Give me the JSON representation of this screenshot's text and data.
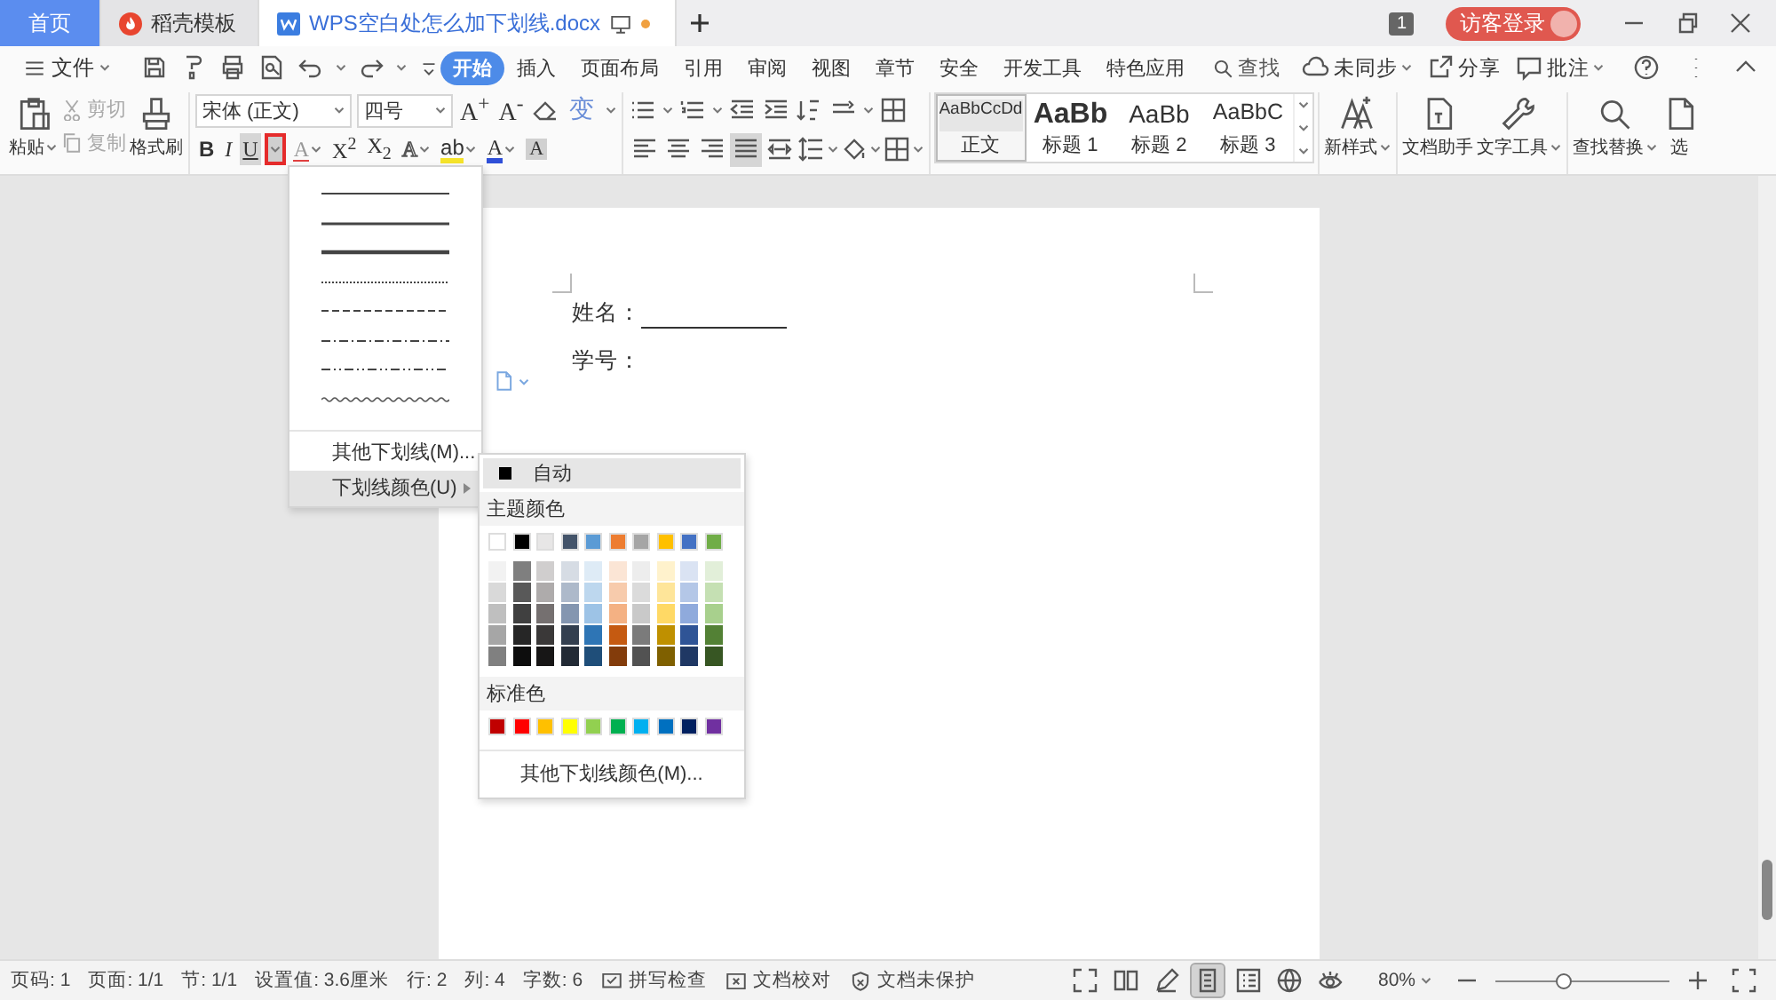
{
  "tab_bar": {
    "tabs": [
      {
        "kind": "home",
        "label": "首页",
        "selected": false
      },
      {
        "kind": "template",
        "label": "稻壳模板",
        "selected": false
      },
      {
        "kind": "document",
        "label": "WPS空白处怎么加下划线.docx",
        "selected": true
      }
    ],
    "badge": "1",
    "login": "访客登录"
  },
  "menu_bar": {
    "file": "文件",
    "tabs": [
      {
        "label": "开始",
        "selected": true
      },
      {
        "label": "插入",
        "selected": false
      },
      {
        "label": "页面布局",
        "selected": false
      },
      {
        "label": "引用",
        "selected": false
      },
      {
        "label": "审阅",
        "selected": false
      },
      {
        "label": "视图",
        "selected": false
      },
      {
        "label": "章节",
        "selected": false
      },
      {
        "label": "安全",
        "selected": false
      },
      {
        "label": "开发工具",
        "selected": false
      },
      {
        "label": "特色应用",
        "selected": false
      }
    ],
    "search": "查找",
    "actions": [
      {
        "kind": "sync",
        "label": "未同步"
      },
      {
        "kind": "share",
        "label": "分享"
      },
      {
        "kind": "comment",
        "label": "批注"
      }
    ]
  },
  "ribbon": {
    "paste": "粘贴",
    "cut": "剪切",
    "copy": "复制",
    "format_painter": "格式刷",
    "font_name": "宋体 (正文)",
    "font_size": "四号",
    "size_buttons": [
      "A$^{+}$",
      "A$^{-}$"
    ],
    "pinyin": "变",
    "format_buttons": [
      {
        "kind": "bold",
        "label": "B",
        "pressed": false
      },
      {
        "kind": "italic",
        "label": "I",
        "pressed": false
      },
      {
        "kind": "underline",
        "label": "U",
        "pressed": true
      },
      {
        "kind": "strike",
        "label": "A",
        "pressed": false
      },
      {
        "kind": "superscript",
        "label": "X$^{2}$",
        "pressed": false
      },
      {
        "kind": "subscript",
        "label": "X$_{2}$",
        "pressed": false
      },
      {
        "kind": "effect",
        "label": "A",
        "pressed": false
      },
      {
        "kind": "highlight",
        "label": "ab",
        "pressed": false
      },
      {
        "kind": "font_color",
        "label": "A",
        "pressed": false
      },
      {
        "kind": "shading",
        "label": "A",
        "pressed": false
      }
    ],
    "align_buttons": [
      {
        "kind": "left",
        "selected": false
      },
      {
        "kind": "center",
        "selected": false
      },
      {
        "kind": "right",
        "selected": false
      },
      {
        "kind": "justify",
        "selected": true
      },
      {
        "kind": "distribute",
        "selected": false
      }
    ],
    "styles": [
      {
        "kind": "body",
        "preview": "AaBbCcDd",
        "label": "正文",
        "selected": true
      },
      {
        "kind": "h1",
        "preview": "AaBb",
        "label": "标题 1",
        "selected": false
      },
      {
        "kind": "h2",
        "preview": "AaBb",
        "label": "标题 2",
        "selected": false
      },
      {
        "kind": "h3",
        "preview": "AaBbC",
        "label": "标题 3",
        "selected": false
      }
    ],
    "new_style": "新样式",
    "doc_assistant": "文档助手",
    "text_tools": "文字工具",
    "find_replace": "查找替换",
    "select": "选"
  },
  "document": {
    "lines": [
      {
        "label": "姓名：",
        "blank": true
      },
      {
        "label": "学号：",
        "blank": false
      }
    ]
  },
  "underline_menu": {
    "open": true,
    "line_styles": [
      {
        "kind": "single"
      },
      {
        "kind": "medium"
      },
      {
        "kind": "thick"
      },
      {
        "kind": "dotted"
      },
      {
        "kind": "dashed"
      },
      {
        "kind": "dash_dot"
      },
      {
        "kind": "dash_dot_dot"
      },
      {
        "kind": "wavy"
      }
    ],
    "items": [
      {
        "label": "其他下划线(M)...",
        "submenu": false,
        "selected": false
      },
      {
        "label": "下划线颜色(U)",
        "submenu": true,
        "selected": true
      }
    ]
  },
  "color_menu": {
    "auto": "自动",
    "theme_title": "主题颜色",
    "theme_colors": [
      {
        "color": "#ffffff"
      },
      {
        "color": "#000000"
      },
      {
        "color": "#e7e6e6"
      },
      {
        "color": "#44546a"
      },
      {
        "color": "#5b9bd5"
      },
      {
        "color": "#ed7d31"
      },
      {
        "color": "#a5a5a5"
      },
      {
        "color": "#ffc000"
      },
      {
        "color": "#4472c4"
      },
      {
        "color": "#70ad47"
      }
    ],
    "shades": [
      {
        "swatches": [
          {
            "color": "#f2f2f2"
          },
          {
            "color": "#7f7f7f"
          },
          {
            "color": "#d0cece"
          },
          {
            "color": "#d6dce4"
          },
          {
            "color": "#deebf6"
          },
          {
            "color": "#fbe5d5"
          },
          {
            "color": "#ededed"
          },
          {
            "color": "#fff2cc"
          },
          {
            "color": "#dae3f3"
          },
          {
            "color": "#e2efd9"
          }
        ]
      },
      {
        "swatches": [
          {
            "color": "#d9d9d9"
          },
          {
            "color": "#595959"
          },
          {
            "color": "#aeabab"
          },
          {
            "color": "#adb9ca"
          },
          {
            "color": "#bdd7ee"
          },
          {
            "color": "#f7cbac"
          },
          {
            "color": "#dbdbdb"
          },
          {
            "color": "#fee599"
          },
          {
            "color": "#b4c7e7"
          },
          {
            "color": "#c5e0b3"
          }
        ]
      },
      {
        "swatches": [
          {
            "color": "#bfbfbf"
          },
          {
            "color": "#404040"
          },
          {
            "color": "#757070"
          },
          {
            "color": "#8496b0"
          },
          {
            "color": "#9dc3e6"
          },
          {
            "color": "#f4b183"
          },
          {
            "color": "#c9c9c9"
          },
          {
            "color": "#ffd965"
          },
          {
            "color": "#8faadc"
          },
          {
            "color": "#a8d08d"
          }
        ]
      },
      {
        "swatches": [
          {
            "color": "#a6a6a6"
          },
          {
            "color": "#262626"
          },
          {
            "color": "#3a3838"
          },
          {
            "color": "#333f4f"
          },
          {
            "color": "#2e75b5"
          },
          {
            "color": "#c55a11"
          },
          {
            "color": "#7b7b7b"
          },
          {
            "color": "#bf9000"
          },
          {
            "color": "#2f5496"
          },
          {
            "color": "#538135"
          }
        ]
      },
      {
        "swatches": [
          {
            "color": "#808080"
          },
          {
            "color": "#0d0d0d"
          },
          {
            "color": "#171616"
          },
          {
            "color": "#222a35"
          },
          {
            "color": "#1f4e79"
          },
          {
            "color": "#833c0b"
          },
          {
            "color": "#525252"
          },
          {
            "color": "#7f6000"
          },
          {
            "color": "#1f3864"
          },
          {
            "color": "#375623"
          }
        ]
      }
    ],
    "standard_title": "标准色",
    "standard_colors": [
      {
        "color": "#c00000"
      },
      {
        "color": "#ff0000"
      },
      {
        "color": "#ffc000"
      },
      {
        "color": "#ffff00"
      },
      {
        "color": "#92d050"
      },
      {
        "color": "#00b050"
      },
      {
        "color": "#00b0f0"
      },
      {
        "color": "#0070c0"
      },
      {
        "color": "#002060"
      },
      {
        "color": "#7030a0"
      }
    ],
    "more": "其他下划线颜色(M)..."
  },
  "status_bar": {
    "items": [
      "页码: 1",
      "页面: 1/1",
      "节: 1/1",
      "设置值: 3.6厘米",
      "行: 2",
      "列: 4",
      "字数: 6"
    ],
    "tools": [
      {
        "kind": "spell",
        "label": "拼写检查"
      },
      {
        "kind": "proof",
        "label": "文档校对"
      },
      {
        "kind": "protect",
        "label": "文档未保护"
      }
    ],
    "views": [
      {
        "kind": "fullscreen",
        "selected": false
      },
      {
        "kind": "reading",
        "selected": false
      },
      {
        "kind": "pen",
        "selected": false
      },
      {
        "kind": "page",
        "selected": true
      },
      {
        "kind": "outline",
        "selected": false
      },
      {
        "kind": "web",
        "selected": false
      },
      {
        "kind": "eye",
        "selected": false
      }
    ],
    "zoom": "80%",
    "zoom_slider": {
      "level": 0.4
    }
  }
}
